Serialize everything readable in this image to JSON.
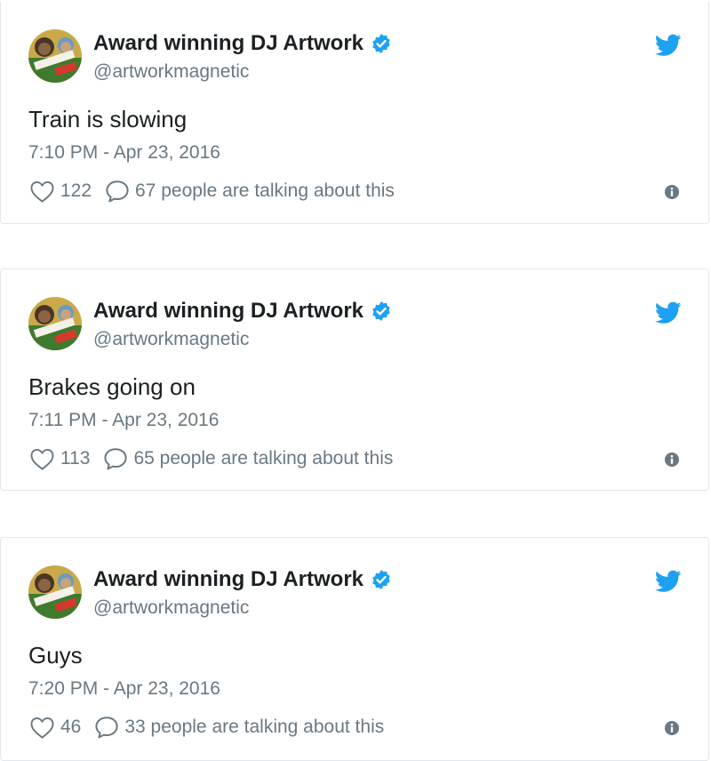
{
  "tweets": [
    {
      "name": "Award winning DJ Artwork",
      "handle": "@artworkmagnetic",
      "text": "Train is slowing",
      "time": "7:10 PM - Apr 23, 2016",
      "likes": "122",
      "talking": "67 people are talking about this"
    },
    {
      "name": "Award winning DJ Artwork",
      "handle": "@artworkmagnetic",
      "text": "Brakes going on",
      "time": "7:11 PM - Apr 23, 2016",
      "likes": "113",
      "talking": "65 people are talking about this"
    },
    {
      "name": "Award winning DJ Artwork",
      "handle": "@artworkmagnetic",
      "text": "Guys",
      "time": "7:20 PM - Apr 23, 2016",
      "likes": "46",
      "talking": "33 people are talking about this"
    }
  ],
  "icons": {
    "verified": "verified-badge-icon",
    "brand": "twitter-bird-icon",
    "like": "heart-icon",
    "reply": "reply-bubble-icon",
    "info": "info-icon"
  },
  "colors": {
    "twitter_blue": "#1da1f2",
    "text": "#1c2022",
    "muted": "#697882",
    "border": "#e1e8ed"
  }
}
